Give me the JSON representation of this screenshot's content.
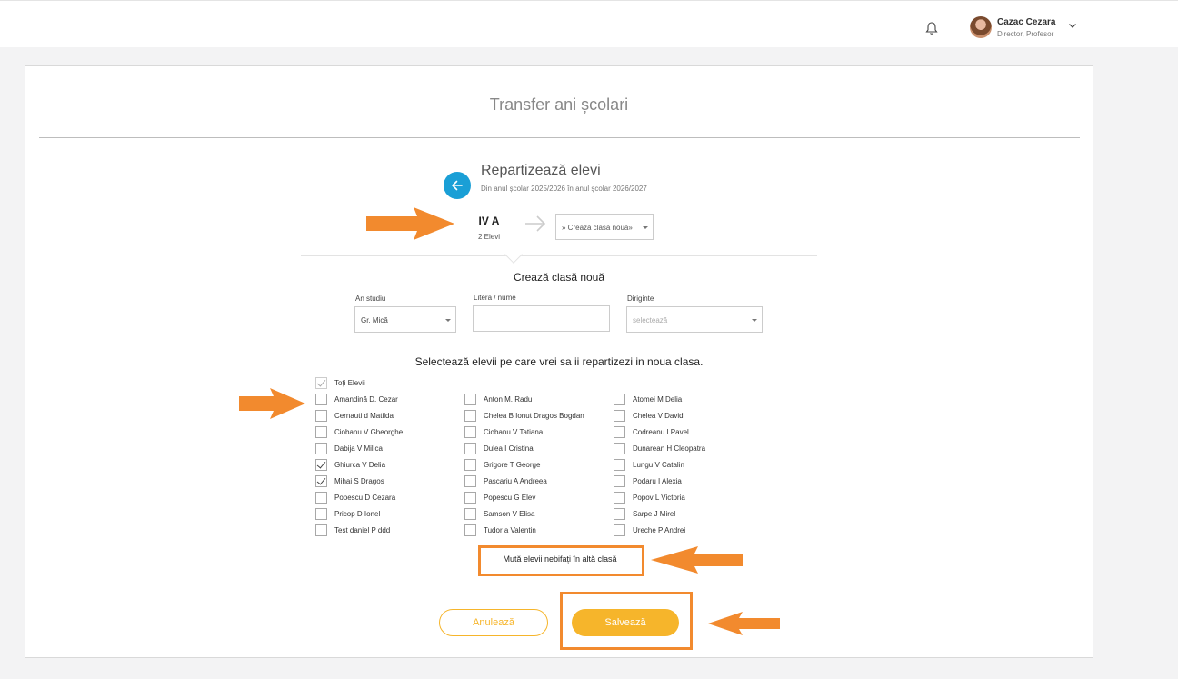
{
  "header": {
    "user_name": "Cazac Cezara",
    "user_role": "Director, Profesor"
  },
  "page": {
    "title": "Transfer ani școlari"
  },
  "section": {
    "title": "Repartizează elevi",
    "subtitle": "Din anul școlar 2025/2026 în anul școlar 2026/2027"
  },
  "transfer": {
    "from_class": "IV A",
    "from_count": "2 Elevi",
    "to_select_value": "» Crează clasă nouă»"
  },
  "new_class": {
    "title": "Crează clasă nouă",
    "an_studiu_label": "An studiu",
    "an_studiu_value": "Gr. Mică",
    "litera_label": "Litera / nume",
    "litera_value": "",
    "diriginte_label": "Diriginte",
    "diriginte_placeholder": "selectează"
  },
  "students": {
    "instruction": "Selectează elevii pe care vrei sa ii repartizezi in noua clasa.",
    "all_label": "Toți Elevii",
    "col1": [
      {
        "name": "Amandină D. Cezar",
        "checked": false
      },
      {
        "name": "Cernauti d Matilda",
        "checked": false
      },
      {
        "name": "Ciobanu V Gheorghe",
        "checked": false
      },
      {
        "name": "Dabija V Milica",
        "checked": false
      },
      {
        "name": "Ghiurca V Delia",
        "checked": true
      },
      {
        "name": "Mihai S Dragos",
        "checked": true
      },
      {
        "name": "Popescu D Cezara",
        "checked": false
      },
      {
        "name": "Pricop D Ionel",
        "checked": false
      },
      {
        "name": "Test daniel P ddd",
        "checked": false
      }
    ],
    "col2": [
      {
        "name": "Anton M. Radu",
        "checked": false
      },
      {
        "name": "Chelea B Ionut Dragos Bogdan",
        "checked": false
      },
      {
        "name": "Ciobanu V Tatiana",
        "checked": false
      },
      {
        "name": "Dulea I Cristina",
        "checked": false
      },
      {
        "name": "Grigore T George",
        "checked": false
      },
      {
        "name": "Pascariu A Andreea",
        "checked": false
      },
      {
        "name": "Popescu G Elev",
        "checked": false
      },
      {
        "name": "Samson V Elisa",
        "checked": false
      },
      {
        "name": "Tudor a Valentin",
        "checked": false
      }
    ],
    "col3": [
      {
        "name": "Atomei M Delia",
        "checked": false
      },
      {
        "name": "Chelea V David",
        "checked": false
      },
      {
        "name": "Codreanu I Pavel",
        "checked": false
      },
      {
        "name": "Dunarean H Cleopatra",
        "checked": false
      },
      {
        "name": "Lungu V Catalin",
        "checked": false
      },
      {
        "name": "Podaru I Alexia",
        "checked": false
      },
      {
        "name": "Popov L Victoria",
        "checked": false
      },
      {
        "name": "Sarpe J Mirel",
        "checked": false
      },
      {
        "name": "Ureche P Andrei",
        "checked": false
      }
    ],
    "move_unchecked_label": "Mută elevii nebifați în altă clasă"
  },
  "actions": {
    "cancel_label": "Anulează",
    "save_label": "Salvează"
  },
  "colors": {
    "accent_blue": "#1a9fd6",
    "accent_yellow": "#f6b52b",
    "annotation_orange": "#f28a2e"
  }
}
